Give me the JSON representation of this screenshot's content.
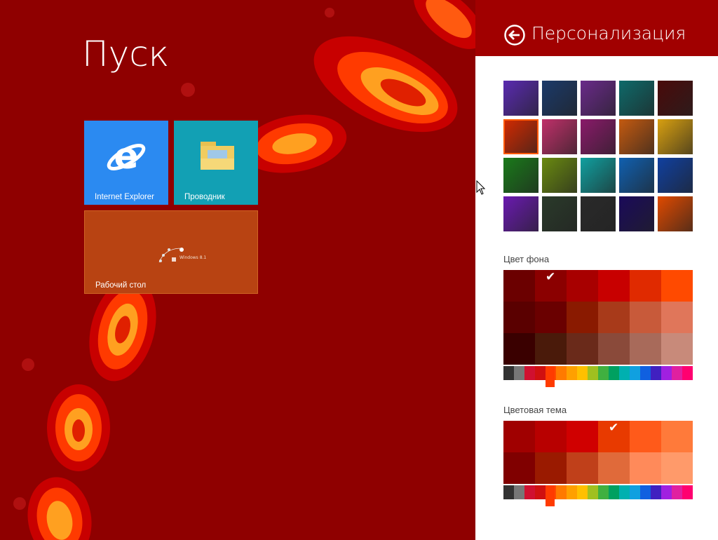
{
  "start": {
    "title": "Пуск",
    "tiles": {
      "ie": "Internet Explorer",
      "explorer": "Проводник",
      "desktop": "Рабочий стол",
      "desktop_preview_text": "Windows 8.1"
    }
  },
  "panel": {
    "title": "Персонализация",
    "background_color_label": "Цвет фона",
    "color_theme_label": "Цветовая тема",
    "backgrounds": [
      [
        "#5a2bb0",
        "#1b3a6a",
        "#6a2a8a",
        "#0e6a6a",
        "#4a0a0a"
      ],
      [
        "#d42a00",
        "#c0306a",
        "#8a1a6a",
        "#c45a10",
        "#d8a010"
      ],
      [
        "#1a7a1a",
        "#6a8a10",
        "#10a0a0",
        "#1060b0",
        "#1040a0"
      ],
      [
        "#6a1ab0",
        "#2a3a2a",
        "#2a2a2a",
        "#1a0a5a",
        "#e04a00"
      ]
    ],
    "background_colors": [
      [
        "#6b0000",
        "#8b0000",
        "#a80000",
        "#c80000",
        "#e02a00",
        "#ff4a00"
      ],
      [
        "#5a0000",
        "#6a0000",
        "#8a1a00",
        "#a83a1a",
        "#c85a3a",
        "#e0765a"
      ],
      [
        "#3a0000",
        "#4a1a0a",
        "#6a2a1a",
        "#8a4a3a",
        "#a86a5a",
        "#c88a7a"
      ]
    ],
    "color_theme": [
      [
        "#a00000",
        "#b80000",
        "#d00000",
        "#e83a00",
        "#ff5a1a",
        "#ff7a3a"
      ],
      [
        "#800000",
        "#9a1a00",
        "#c0401a",
        "#e06a3a",
        "#ff8a5a",
        "#ff9a6a"
      ]
    ],
    "hue_strip": [
      "#333333",
      "#777777",
      "#d01030",
      "#d01010",
      "#ff4a00",
      "#ff7a00",
      "#ffa000",
      "#ffc000",
      "#a0c020",
      "#40b040",
      "#00a060",
      "#00b0b0",
      "#10a0e0",
      "#1060e0",
      "#4020c0",
      "#a020e0",
      "#e020a0",
      "#ff0070"
    ],
    "selected_background_index": 5,
    "selected_bg_color": [
      0,
      1
    ],
    "selected_theme_color": [
      0,
      3
    ],
    "accent": "#a10000"
  }
}
